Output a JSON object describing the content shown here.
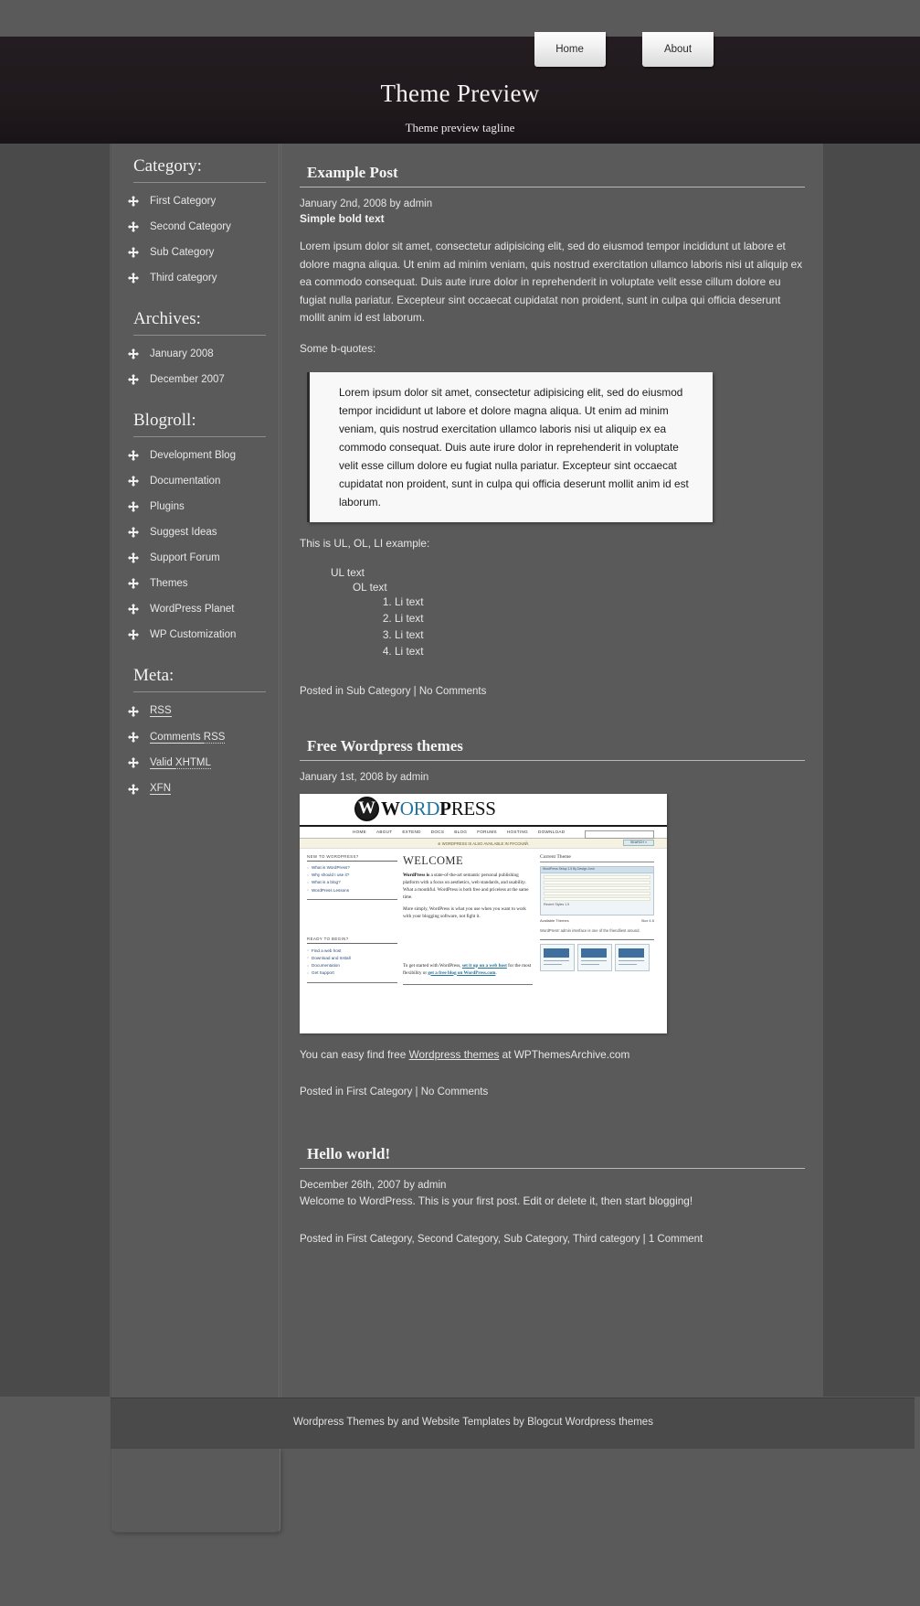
{
  "header": {
    "title": "Theme Preview",
    "tagline": "Theme preview tagline",
    "nav": [
      {
        "label": "Home"
      },
      {
        "label": "About"
      }
    ]
  },
  "sidebar": {
    "sections": [
      {
        "heading": "Category:",
        "items": [
          {
            "label": "First Category",
            "icon": "move-cross-icon"
          },
          {
            "label": "Second Category",
            "icon": "move-cross-icon"
          },
          {
            "label": "Sub Category",
            "icon": "move-cross-icon"
          },
          {
            "label": "Third category",
            "icon": "move-cross-icon"
          }
        ]
      },
      {
        "heading": "Archives:",
        "items": [
          {
            "label": "January 2008",
            "icon": "move-cross-icon"
          },
          {
            "label": "December 2007",
            "icon": "move-cross-icon"
          }
        ]
      },
      {
        "heading": "Blogroll:",
        "items": [
          {
            "label": "Development Blog",
            "icon": "move-cross-icon"
          },
          {
            "label": "Documentation",
            "icon": "move-cross-icon"
          },
          {
            "label": "Plugins",
            "icon": "move-cross-icon"
          },
          {
            "label": "Suggest Ideas",
            "icon": "move-cross-icon"
          },
          {
            "label": "Support Forum",
            "icon": "move-cross-icon"
          },
          {
            "label": "Themes",
            "icon": "move-cross-icon"
          },
          {
            "label": "WordPress Planet",
            "icon": "move-cross-icon"
          },
          {
            "label": "WP Customization",
            "icon": "move-cross-icon"
          }
        ]
      },
      {
        "heading": "Meta:",
        "items": [
          {
            "label": "RSS",
            "icon": "move-cross-icon",
            "style": "abbr"
          },
          {
            "label": "Comments ",
            "abbr": "RSS",
            "icon": "move-cross-icon",
            "style": "split-abbr"
          },
          {
            "label": "Valid ",
            "abbr": "XHTML",
            "icon": "move-cross-icon",
            "style": "split-abbr"
          },
          {
            "label": "XFN",
            "icon": "move-cross-icon",
            "style": "abbr"
          }
        ]
      }
    ]
  },
  "posts": [
    {
      "title": "Example Post",
      "meta": "January 2nd, 2008 by admin",
      "bold_text": "Simple bold text",
      "paragraph": "Lorem ipsum dolor sit amet, consectetur adipisicing elit, sed do eiusmod tempor incididunt ut labore et dolore magna aliqua. Ut enim ad minim veniam, quis nostrud exercitation ullamco laboris nisi ut aliquip ex ea commodo consequat. Duis aute irure dolor in reprehenderit in voluptate velit esse cillum dolore eu fugiat nulla pariatur. Excepteur sint occaecat cupidatat non proident, sunt in culpa qui officia deserunt mollit anim id est laborum.",
      "quote_intro": "Some b-quotes:",
      "blockquote": "Lorem ipsum dolor sit amet, consectetur adipisicing elit, sed do eiusmod tempor incididunt ut labore et dolore magna aliqua. Ut enim ad minim veniam, quis nostrud exercitation ullamco laboris nisi ut aliquip ex ea commodo consequat. Duis aute irure dolor in reprehenderit in voluptate velit esse cillum dolore eu fugiat nulla pariatur. Excepteur sint occaecat cupidatat non proident, sunt in culpa qui officia deserunt mollit anim id est laborum.",
      "list_intro": "This is UL, OL, LI example:",
      "ul_text": "UL text",
      "ol_text": "OL text",
      "li_items": [
        "Li text",
        "Li text",
        "Li text",
        "Li text"
      ],
      "posted": "Posted in Sub Category | No Comments"
    },
    {
      "title": "Free Wordpress themes",
      "meta": "January 1st, 2008 by admin",
      "body_pre": "You can easy find free ",
      "body_link": "Wordpress themes",
      "body_post": " at WPThemesArchive.com",
      "posted": "Posted in First Category | No Comments"
    },
    {
      "title": "Hello world!",
      "meta": "December 26th, 2007 by admin",
      "body": "Welcome to WordPress. This is your first post. Edit or delete it, then start blogging!",
      "posted": "Posted in First Category, Second Category, Sub Category, Third category | 1 Comment"
    }
  ],
  "wp_screenshot": {
    "logo_word": "W",
    "logo_text_1": "W",
    "logo_text_2": "ORD",
    "logo_text_3": "P",
    "logo_text_4": "RESS",
    "nav": [
      "HOME",
      "ABOUT",
      "EXTEND",
      "DOCS",
      "BLOG",
      "FORUMS",
      "HOSTING",
      "DOWNLOAD"
    ],
    "search_button": "SEARCH »",
    "banner": "⊕ WORDPRESS IS ALSO AVAILABLE IN РУССКИЙ.",
    "col1_head1": "NEW TO WORDPRESS?",
    "col1_items1": [
      "What is WordPress?",
      "Why should I use it?",
      "What is a blog?",
      "WordPress Lessons"
    ],
    "col1_head2": "READY TO BEGIN?",
    "col1_items2": [
      "Find a web host",
      "Download and Install",
      "Documentation",
      "Get Support"
    ],
    "welcome": "WELCOME",
    "p1_bold": "WordPress is",
    "p1": " a state-of-the-art semantic personal publishing platform with a focus on aesthetics, web standards, and usability. What a mouthful. WordPress is both free and priceless at the same time.",
    "p2": "More simply, WordPress is what you use when you want to work with your blogging software, not fight it.",
    "p3_pre": "To get started with WordPress, ",
    "p3_link1": "set it up on a web host",
    "p3_mid": " for the most flexibility or ",
    "p3_link2": "get a free blog on WordPress.com",
    "p3_end": ".",
    "current_theme": "Current Theme",
    "theme_bar": "WordPress Setup 1.5 By Design Josh",
    "theme_label": "Recent Styles 1.5",
    "available": "Available Themes",
    "available_sub": "Box 4.5",
    "caption": "WordPress' admin interface is one of the friendliest around."
  },
  "footer": {
    "text": "Wordpress Themes by and Website Templates by Blogcut Wordpress themes"
  }
}
